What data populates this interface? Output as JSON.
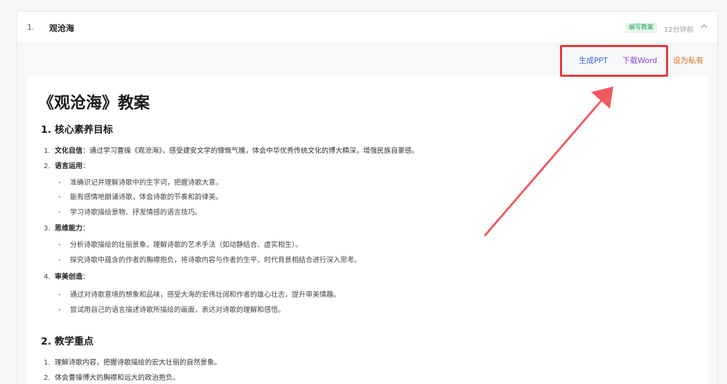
{
  "item": {
    "index": "1.",
    "title": "观沧海",
    "tag": "编写教案",
    "time": "12分钟前"
  },
  "actions": {
    "ppt": "生成PPT",
    "word": "下载Word",
    "private": "设为私有"
  },
  "doc": {
    "title": "《观沧海》教案",
    "section1": {
      "heading": "1. 核心素养目标",
      "items": [
        {
          "num": "1.",
          "label": "文化自信",
          "text": "：通过学习曹操《观沧海》，感受建安文学的慷慨气魄，体会中华优秀传统文化的博大精深，增强民族自豪感。"
        },
        {
          "num": "2.",
          "label": "语言运用",
          "text": "：",
          "subs": [
            "准确识记并理解诗歌中的生字词，把握诗歌大意。",
            "能有感情地朗诵诗歌，体会诗歌的节奏和韵律美。",
            "学习诗歌描绘景物、抒发情感的语言技巧。"
          ]
        },
        {
          "num": "3.",
          "label": "思维能力",
          "text": "：",
          "subs": [
            "分析诗歌描绘的壮丽景象，理解诗歌的艺术手法（如动静结合、虚实相生）。",
            "探究诗歌中蕴含的作者的胸襟抱负，将诗歌内容与作者的生平、时代背景相结合进行深入思考。"
          ]
        },
        {
          "num": "4.",
          "label": "审美创造",
          "text": "：",
          "subs": [
            "通过对诗歌意境的想象和品味，感受大海的宏伟壮阔和作者的雄心壮志，提升审美情趣。",
            "尝试用自己的语言描述诗歌所描绘的画面，表达对诗歌的理解和感悟。"
          ]
        }
      ]
    },
    "section2": {
      "heading": "2. 教学重点",
      "items": [
        {
          "num": "1.",
          "text": "理解诗歌内容，把握诗歌描绘的宏大壮丽的自然景象。"
        },
        {
          "num": "2.",
          "text": "体会曹操博大的胸襟和远大的政治抱负。"
        }
      ]
    }
  },
  "colors": {
    "highlight": "#e8363d",
    "ppt_link": "#3a67d6",
    "word_link": "#8e44c9",
    "private_link": "#e0701e",
    "tag_text": "#2fa35c"
  }
}
